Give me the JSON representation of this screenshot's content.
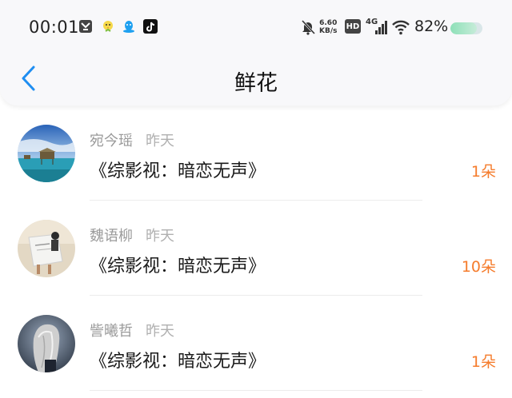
{
  "status_bar": {
    "time": "00:01",
    "net_speed_value": "6.60",
    "net_speed_unit": "KB/s",
    "hd_badge": "HD",
    "network": "4G",
    "battery": "82%",
    "battery_level": 0.82,
    "icons": [
      "app-notify-icon",
      "chick-icon",
      "qq-icon",
      "tiktok-icon",
      "bell-off-icon",
      "hd-icon",
      "signal-icon",
      "wifi-icon",
      "battery-icon"
    ]
  },
  "nav": {
    "title": "鲜花",
    "back_icon": "chevron-left-icon"
  },
  "colors": {
    "accent_blue": "#1f8ef1",
    "count_orange": "#f57c2c"
  },
  "list": [
    {
      "name": "宛今瑶",
      "date": "昨天",
      "book": "《综影视：暗恋无声》",
      "count": "1朵"
    },
    {
      "name": "魏语柳",
      "date": "昨天",
      "book": "《综影视：暗恋无声》",
      "count": "10朵"
    },
    {
      "name": "訾曦哲",
      "date": "昨天",
      "book": "《综影视：暗恋无声》",
      "count": "1朵"
    }
  ]
}
